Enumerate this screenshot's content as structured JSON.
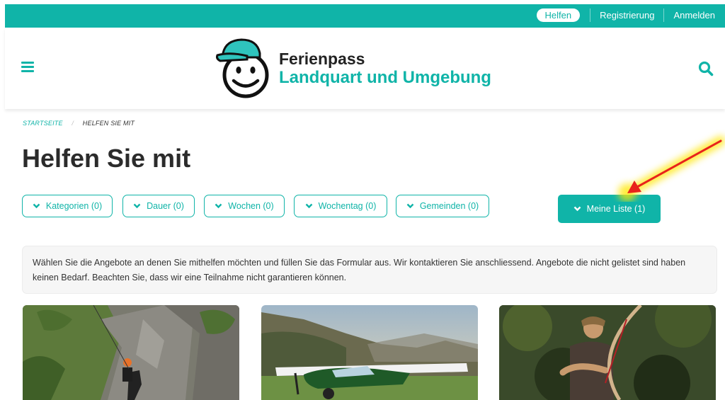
{
  "topbar": {
    "help": "Helfen",
    "register": "Registrierung",
    "login": "Anmelden"
  },
  "brand": {
    "line1": "Ferienpass",
    "line2": "Landquart und Umgebung"
  },
  "icons": {
    "menu": "hamburger-menu-icon",
    "search": "search-icon",
    "chevron": "chevron-down-icon"
  },
  "breadcrumb": {
    "home": "STARTSEITE",
    "separator": "/",
    "current": "HELFEN SIE MIT"
  },
  "page": {
    "title": "Helfen Sie mit"
  },
  "filters": [
    {
      "label": "Kategorien (0)"
    },
    {
      "label": "Dauer (0)"
    },
    {
      "label": "Wochen (0)"
    },
    {
      "label": "Wochentag (0)"
    },
    {
      "label": "Gemeinden (0)"
    }
  ],
  "my_list": {
    "label": "Meine Liste (1)"
  },
  "info_text": "Wählen Sie die Angebote an denen Sie mithelfen möchten und füllen Sie das Formular aus. Wir kontaktieren Sie anschliessend. Angebote die nicht gelistet sind haben keinen Bedarf. Beachten Sie, dass wir eine Teilnahme nicht garantieren können.",
  "colors": {
    "accent": "#10b4a8",
    "annotation_arrow": "#e8221b",
    "annotation_glow": "#ffe600"
  }
}
